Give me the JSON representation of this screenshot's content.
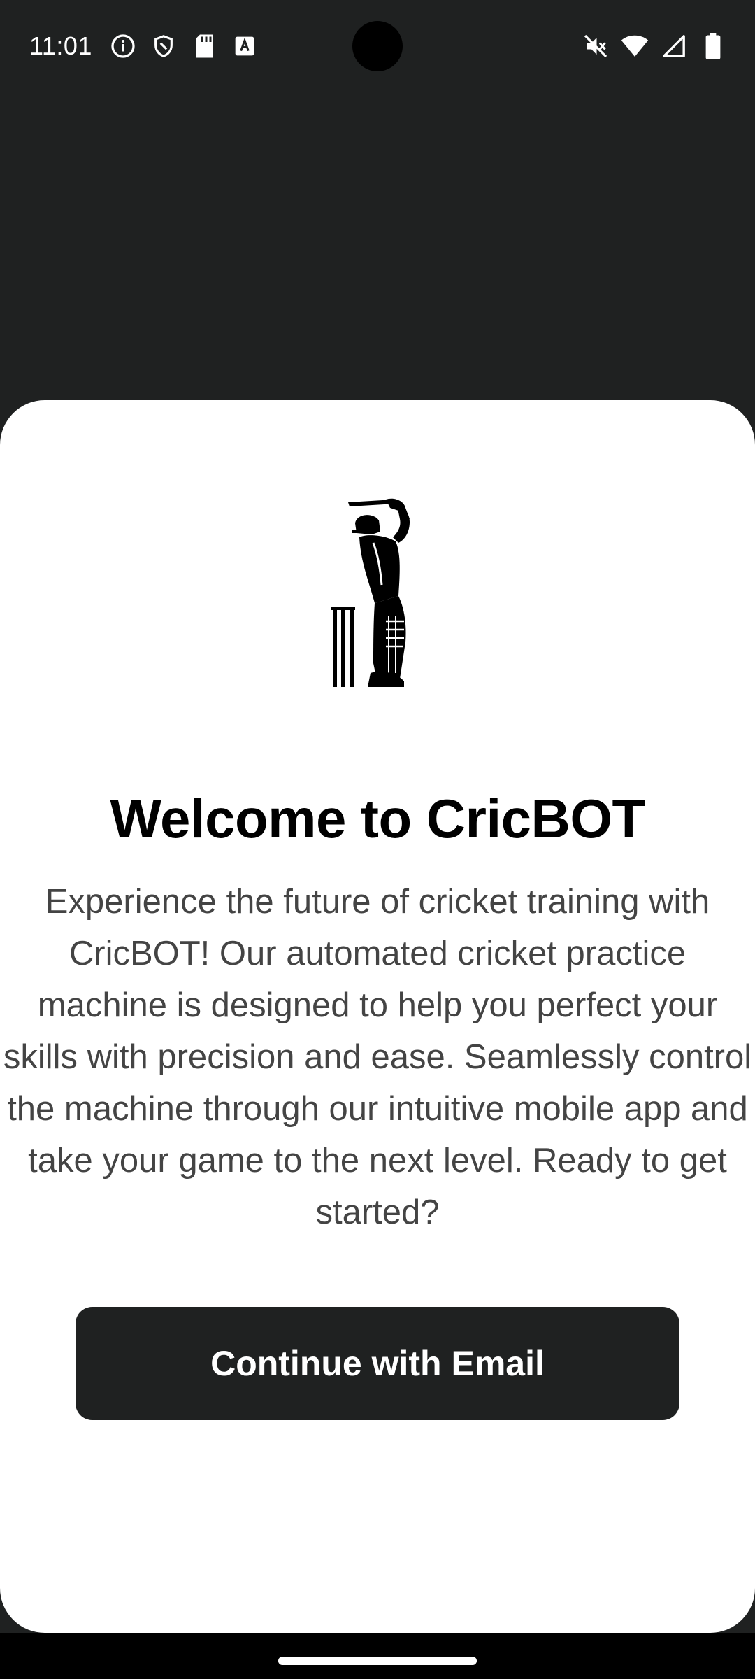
{
  "status_bar": {
    "time": "11:01",
    "left_icons": [
      "info-icon",
      "shield-icon",
      "sd-card-icon",
      "keyboard-a-icon"
    ],
    "right_icons": [
      "vibrate-mute-icon",
      "wifi-icon",
      "cell-signal-icon",
      "battery-icon"
    ]
  },
  "welcome": {
    "logo_icon": "cricket-batsman-icon",
    "title": "Welcome to CricBOT",
    "description": "Experience the future of cricket training with CricBOT! Our automated cricket practice machine is designed to help you perfect your skills with precision and ease. Seamlessly control the machine through our intuitive mobile app and take your game to the next level. Ready to get started?",
    "continue_button_label": "Continue with Email"
  },
  "colors": {
    "background": "#1f2121",
    "sheet": "#ffffff",
    "button": "#1f2121",
    "button_text": "#ffffff",
    "title_text": "#000000",
    "body_text": "#444444"
  }
}
